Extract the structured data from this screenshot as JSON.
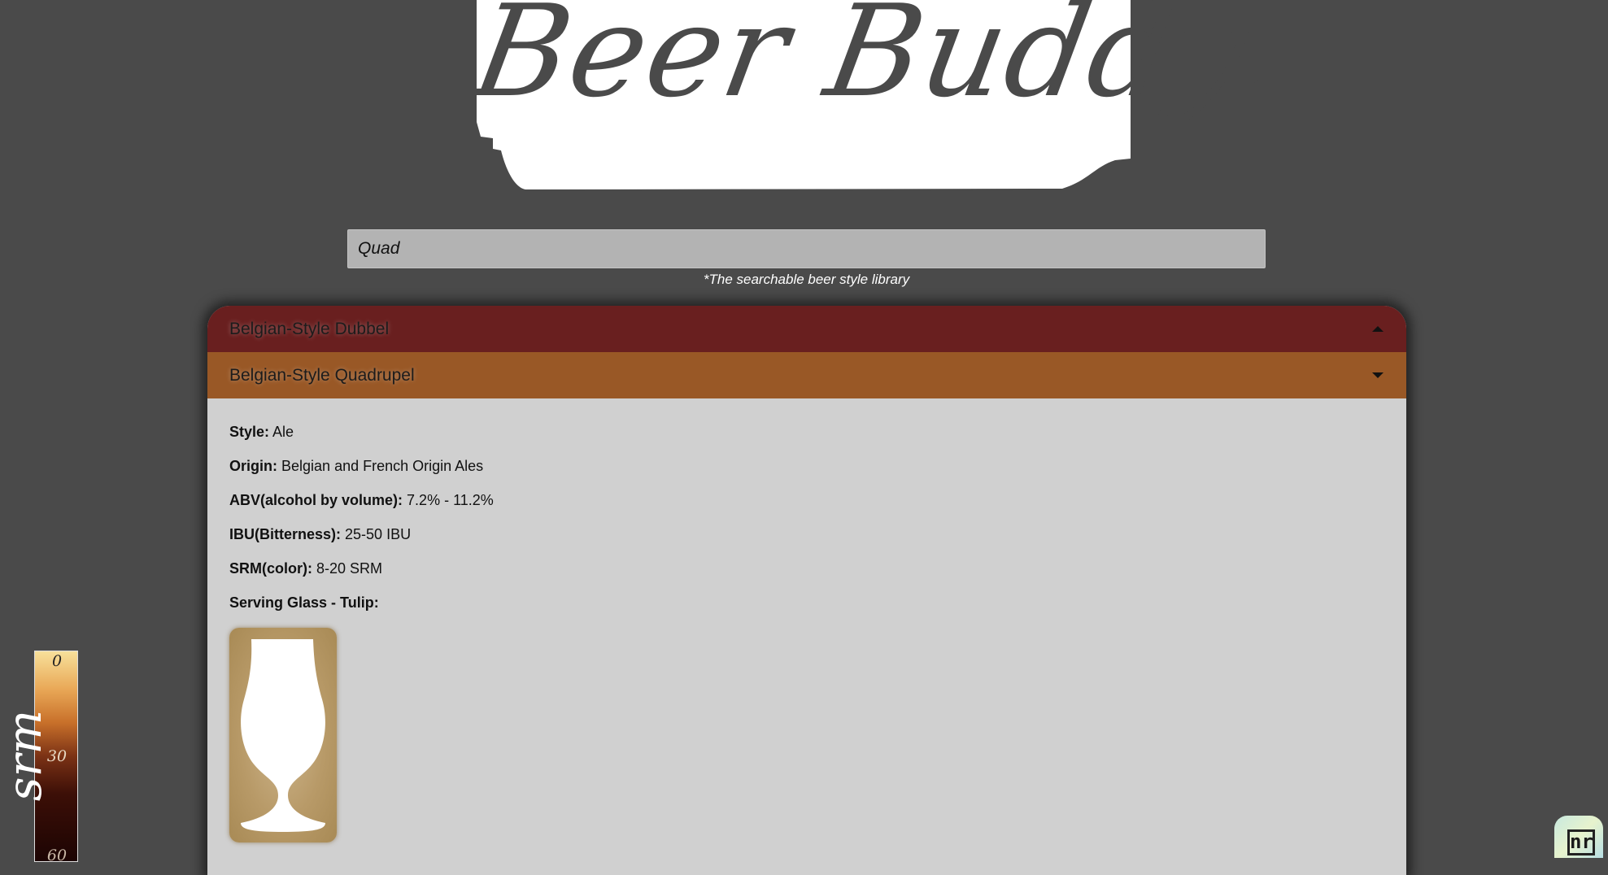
{
  "logo": {
    "text": "Beer Buddy!"
  },
  "search": {
    "value": "Quad",
    "tagline": "*The searchable beer style library"
  },
  "accordion": {
    "items": [
      {
        "label": "Belgian-Style Dubbel",
        "expanded": false,
        "color": "#691f1f"
      },
      {
        "label": "Belgian-Style Quadrupel",
        "expanded": true,
        "color": "#995826"
      }
    ],
    "details": {
      "style_label": "Style:",
      "style_value": "Ale",
      "origin_label": "Origin:",
      "origin_value": "Belgian and French Origin Ales",
      "abv_label": "ABV(alcohol by volume):",
      "abv_value": "7.2% - 11.2%",
      "ibu_label": "IBU(Bitterness):",
      "ibu_value": "25-50 IBU",
      "srm_label": "SRM(color):",
      "srm_value": "8-20 SRM",
      "glass_label": "Serving Glass - Tulip:",
      "glass_icon": "tulip-glass-icon"
    }
  },
  "srm_scale": {
    "title": "srm",
    "ticks": [
      "0",
      "30",
      "60"
    ]
  },
  "badge": {
    "text": "nr"
  },
  "colors": {
    "background": "#4a4a4a",
    "dubbel_header": "#691f1f",
    "quad_header": "#995826",
    "panel_body": "#d0d0d0",
    "search_bg": "#b3b3b3"
  }
}
